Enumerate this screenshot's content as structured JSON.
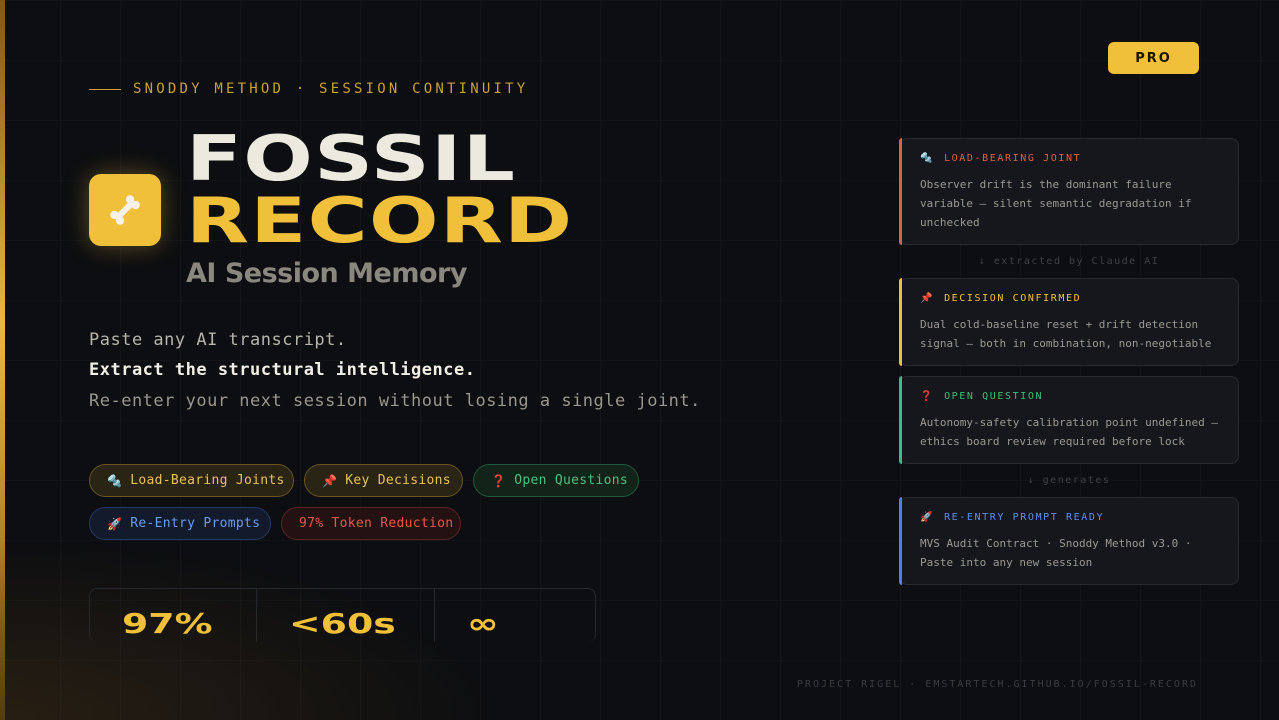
{
  "pro_badge": "PRO",
  "eyebrow": "SNODDY METHOD · SESSION CONTINUITY",
  "title": {
    "line1": "FOSSIL",
    "line2": "RECORD"
  },
  "subtitle": "AI Session Memory",
  "tagline": [
    "Paste any AI transcript.",
    "Extract the structural intelligence.",
    "Re-enter your next session without losing a single joint."
  ],
  "chips": [
    {
      "icon": "🔩",
      "label": "Load-Bearing Joints"
    },
    {
      "icon": "📌",
      "label": "Key Decisions"
    },
    {
      "icon": "❓",
      "label": "Open Questions"
    },
    {
      "icon": "🚀",
      "label": "Re-Entry Prompts"
    },
    {
      "label": "97% Token Reduction"
    }
  ],
  "stats": [
    "97%",
    "<60s",
    "∞"
  ],
  "cards": [
    {
      "icon": "🔩",
      "head": "LOAD-BEARING JOINT",
      "body": "Observer drift is the dominant failure variable — silent semantic degradation if unchecked"
    },
    {
      "icon": "📌",
      "head": "DECISION CONFIRMED",
      "body": "Dual cold-baseline reset + drift detection signal — both in combination, non-negotiable"
    },
    {
      "icon": "❓",
      "head": "OPEN QUESTION",
      "body": "Autonomy-safety calibration point undefined — ethics board review required before lock"
    },
    {
      "icon": "🚀",
      "head": "RE-ENTRY PROMPT READY",
      "body": "MVS Audit Contract · Snoddy Method v3.0 · Paste into any new session"
    }
  ],
  "connectors": [
    "↓ extracted by Claude AI",
    "↓ generates"
  ],
  "footer": "PROJECT RIGEL · EMSTARTECH.GITHUB.IO/FOSSIL-RECORD",
  "colors": {
    "accent": "#f0c03a",
    "background": "#0d0e11",
    "orange": "#e0613a",
    "green": "#3bbf72",
    "blue": "#4a82e8"
  }
}
